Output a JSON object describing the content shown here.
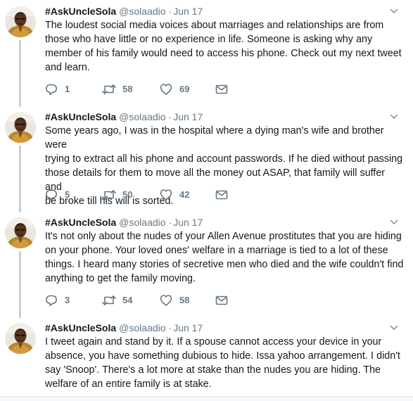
{
  "tweets": [
    {
      "name": "#AskUncleSola",
      "handle": "@solaadio",
      "separator": "·",
      "date": "Jun 17",
      "lines": [
        "The loudest social media voices about marriages and relationships are from",
        "those who have little or no experience in life. Someone is asking why any",
        "member of his family would need to access his phone. Check out my next tweet",
        "and learn."
      ],
      "replies": "1",
      "retweets": "58",
      "likes": "69"
    },
    {
      "name": "#AskUncleSola",
      "handle": "@solaadio",
      "separator": "·",
      "date": "Jun 17",
      "lines": [
        "Some years ago, I was in the hospital where a dying man's wife and brother were",
        "trying to extract all his phone and account passwords. If he died without passing",
        "those details for them to move all the money out ASAP, that family will suffer and",
        "be broke till his will is sorted."
      ],
      "replies": "5",
      "retweets": "50",
      "likes": "42"
    },
    {
      "name": "#AskUncleSola",
      "handle": "@solaadio",
      "separator": "·",
      "date": "Jun 17",
      "lines": [
        "It's not only about the nudes of your Allen Avenue prostitutes that you are hiding",
        "on your phone. Your loved ones' welfare in a marriage is tied to a lot of these",
        "things. I heard many stories of secretive men who died and the wife couldn't find",
        "anything to get the family moving."
      ],
      "replies": "3",
      "retweets": "54",
      "likes": "58"
    },
    {
      "name": "#AskUncleSola",
      "handle": "@solaadio",
      "separator": "·",
      "date": "Jun 17",
      "lines": [
        "I tweet again and stand by it. If a spouse cannot access your device in your",
        "absence, you have something dubious to hide. Issa yahoo arrangement. I didn't",
        "say 'Snoop'. There's a lot more at stake than the nudes you are hiding. The",
        "welfare of an entire family is at stake."
      ]
    }
  ],
  "icons": {
    "reply": "reply-icon",
    "retweet": "retweet-icon",
    "like": "heart-icon",
    "dm": "envelope-icon",
    "more": "chevron-down-icon"
  },
  "colors": {
    "text": "#14171a",
    "secondary": "#657786",
    "thread_line": "#c4cfd6",
    "divider": "#e6ecf0"
  }
}
